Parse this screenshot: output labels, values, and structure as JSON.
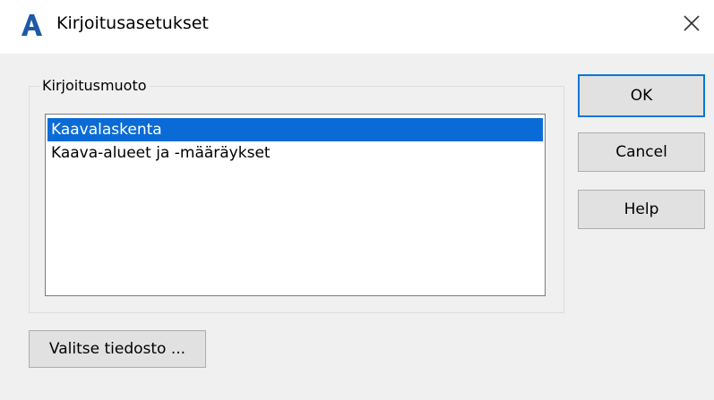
{
  "window": {
    "title": "Kirjoitusasetukset",
    "icon": "autocad-a-icon",
    "close_icon": "close-icon"
  },
  "group": {
    "legend": "Kirjoitusmuoto",
    "items": [
      {
        "label": "Kaavalaskenta",
        "selected": true
      },
      {
        "label": "Kaava-alueet ja -määräykset",
        "selected": false
      }
    ]
  },
  "buttons": {
    "ok": "OK",
    "cancel": "Cancel",
    "help": "Help",
    "select_file": "Valitse tiedosto ..."
  },
  "colors": {
    "selection": "#0a6bd6",
    "default_button_border": "#0078d7",
    "dialog_background": "#f0f0f0"
  }
}
